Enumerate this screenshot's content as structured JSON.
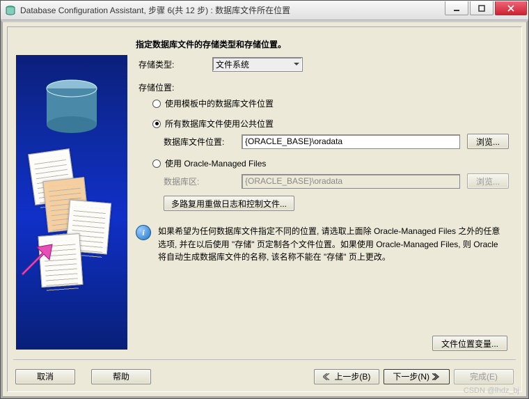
{
  "window": {
    "title": "Database Configuration Assistant, 步骤 6(共 12 步) : 数据库文件所在位置"
  },
  "heading": "指定数据库文件的存储类型和存储位置。",
  "labels": {
    "storage_type": "存储类型:",
    "storage_location": "存储位置:",
    "db_file_location": "数据库文件位置:",
    "db_area": "数据库区:"
  },
  "storage_type_value": "文件系统",
  "radios": {
    "use_template": "使用模板中的数据库文件位置",
    "use_common": "所有数据库文件使用公共位置",
    "use_omf": "使用 Oracle-Managed Files"
  },
  "fields": {
    "db_file_location_value": "{ORACLE_BASE}\\oradata",
    "db_area_value": "{ORACLE_BASE}\\oradata"
  },
  "buttons": {
    "browse1": "浏览...",
    "browse2": "浏览...",
    "multiplex": "多路复用重做日志和控制文件...",
    "file_loc_vars": "文件位置变量...",
    "cancel": "取消",
    "help": "帮助",
    "back": "上一步(B)",
    "next": "下一步(N)",
    "finish": "完成(E)"
  },
  "info_text": "如果希望为任何数据库文件指定不同的位置, 请选取上面除 Oracle-Managed Files 之外的任意选项, 并在以后使用 \"存储\" 页定制各个文件位置。如果使用 Oracle-Managed Files, 则 Oracle 将自动生成数据库文件的名称, 该名称不能在 \"存储\" 页上更改。",
  "watermark": "CSDN @lhdz_bj"
}
